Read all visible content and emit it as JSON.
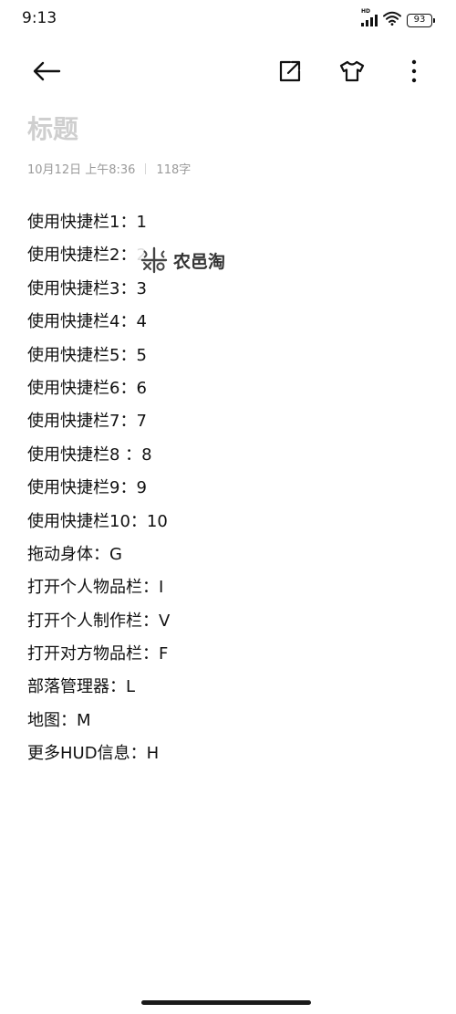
{
  "status_bar": {
    "time": "9:13",
    "network_label": "HD",
    "battery": "93"
  },
  "toolbar": {
    "icons": [
      "back-arrow-icon",
      "share-icon",
      "theme-shirt-icon",
      "more-vertical-icon"
    ]
  },
  "note": {
    "title": "标题",
    "date": "10月12日 上午8:36",
    "char_count": "118字",
    "lines": [
      "使用快捷栏1：1",
      "使用快捷栏2：2",
      "使用快捷栏3：3",
      "使用快捷栏4：4",
      "使用快捷栏5：5",
      "使用快捷栏6：6",
      "使用快捷栏7：7",
      "使用快捷栏8 ：8",
      "使用快捷栏9：9",
      "使用快捷栏10：10",
      "拖动身体：G",
      "打开个人物品栏：I",
      "打开个人制作栏：V",
      "打开对方物品栏：F",
      "部落管理器：L",
      "地图：M",
      "更多HUD信息：H"
    ]
  },
  "watermark": {
    "text": "农邑淘"
  },
  "colors": {
    "background": "#ffffff",
    "text": "#111111",
    "title_placeholder": "#cfcfcf",
    "meta": "#9a9a9a"
  }
}
